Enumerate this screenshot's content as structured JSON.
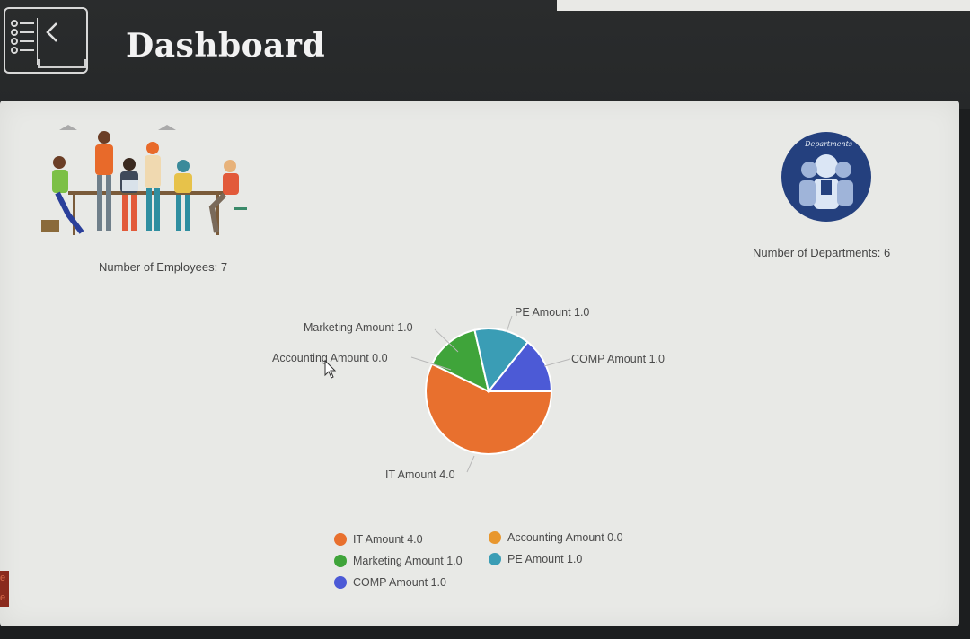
{
  "header": {
    "title": "Dashboard"
  },
  "stats": {
    "employees_label": "Number of Employees: 7",
    "departments_label": "Number of Departments: 6"
  },
  "dept_badge": {
    "caption": "Departments"
  },
  "colors": {
    "it": "#e8702e",
    "accounting": "#e8972e",
    "marketing": "#3fa43a",
    "pe": "#3a9db5",
    "comp": "#4c5ad6"
  },
  "chart_data": {
    "type": "pie",
    "categories": [
      "IT Amount 4.0",
      "Accounting Amount 0.0",
      "Marketing Amount 1.0",
      "PE Amount 1.0",
      "COMP Amount 1.0"
    ],
    "values": [
      4.0,
      0.0,
      1.0,
      1.0,
      1.0
    ],
    "slice_labels": {
      "it": "IT Amount 4.0",
      "accounting": "Accounting Amount 0.0",
      "marketing": "Marketing Amount 1.0",
      "pe": "PE Amount 1.0",
      "comp": "COMP Amount 1.0"
    },
    "legend": [
      {
        "label": "IT Amount 4.0",
        "key": "it"
      },
      {
        "label": "Accounting Amount 0.0",
        "key": "accounting"
      },
      {
        "label": "Marketing Amount 1.0",
        "key": "marketing"
      },
      {
        "label": "PE Amount 1.0",
        "key": "pe"
      },
      {
        "label": "COMP Amount 1.0",
        "key": "comp"
      }
    ],
    "legend_position": "bottom"
  },
  "left_edge": {
    "line1": "e",
    "line2": "e"
  }
}
